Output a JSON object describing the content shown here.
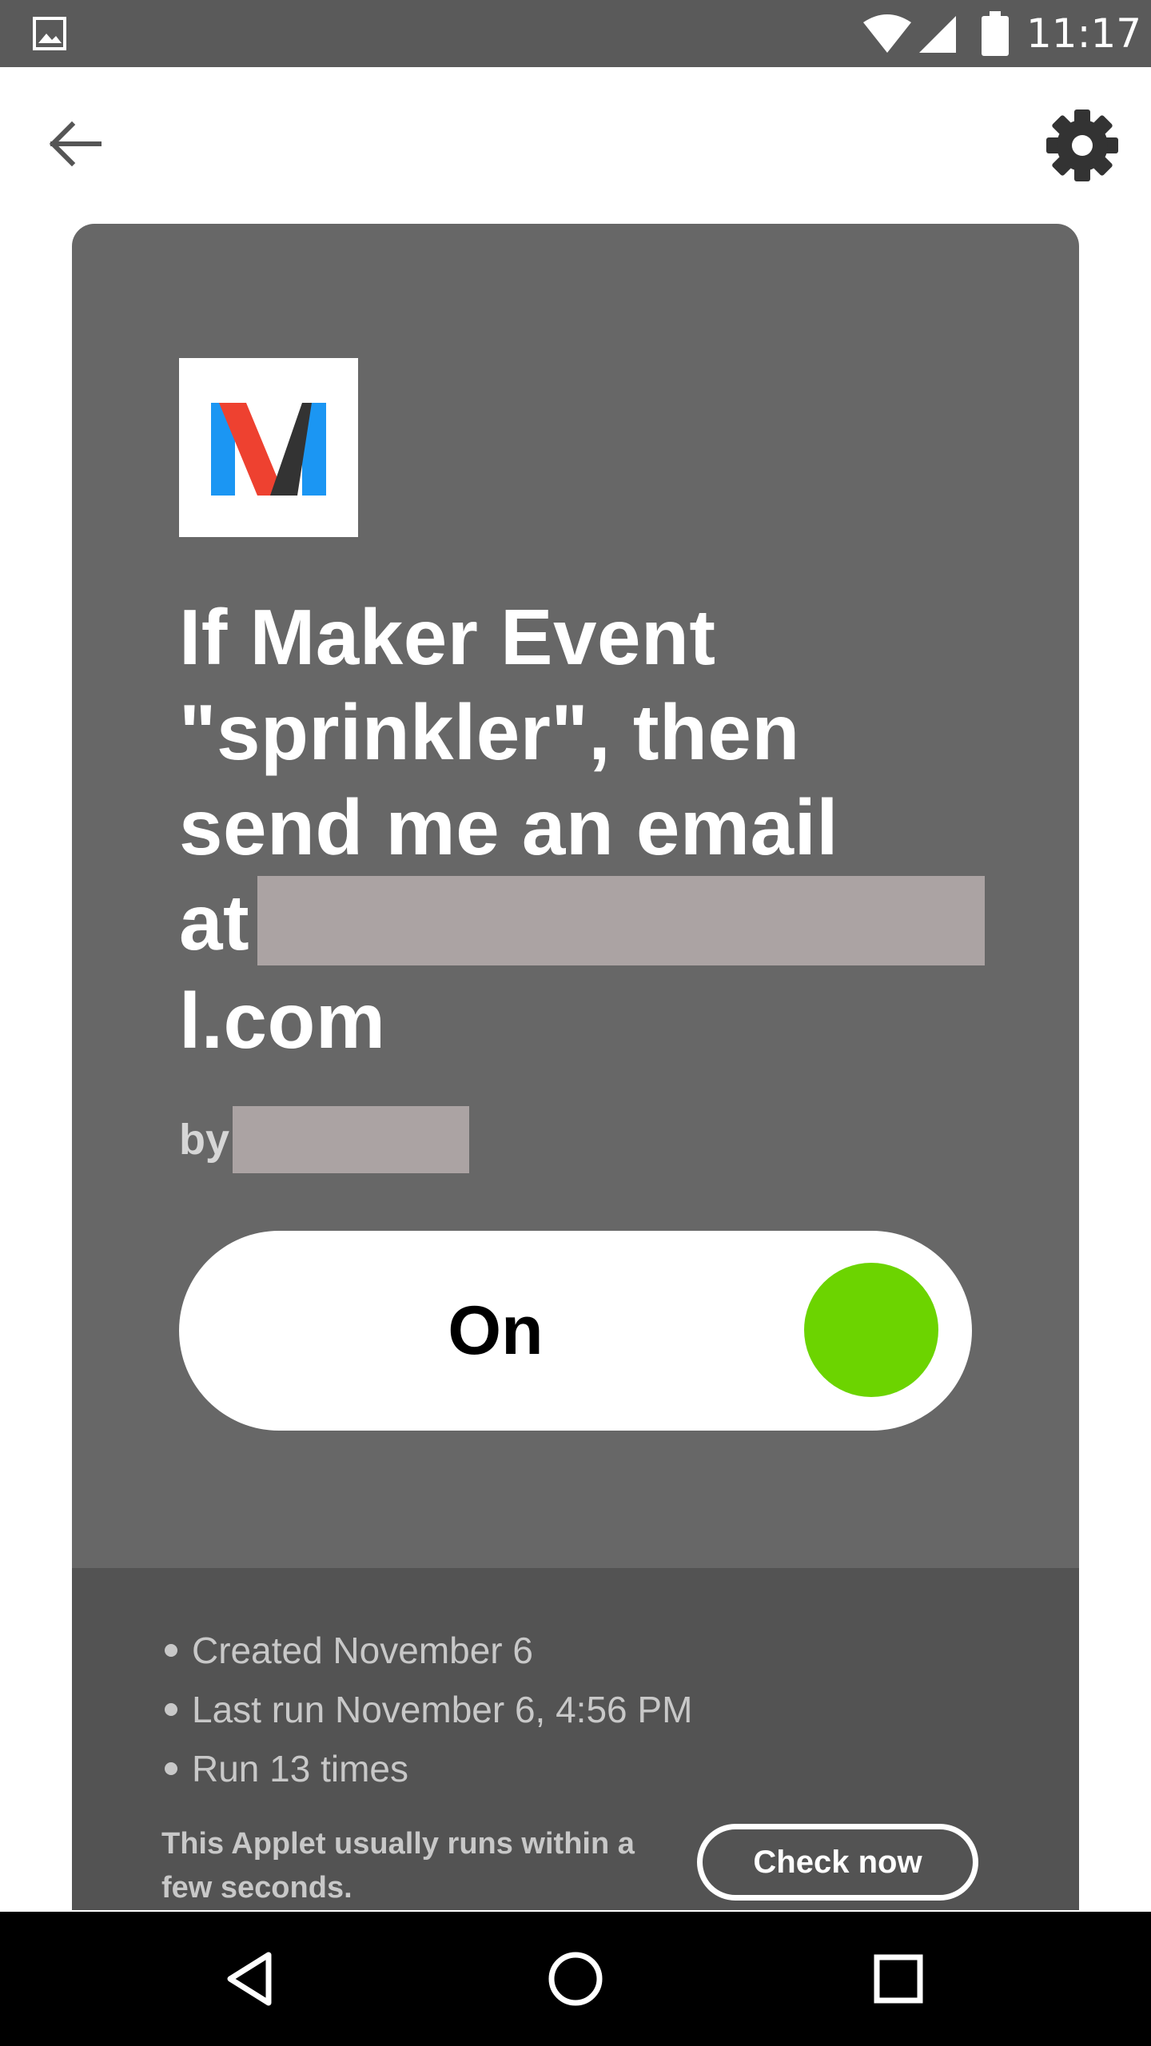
{
  "status_bar": {
    "time": "11:17",
    "icons": [
      "gallery-icon",
      "wifi-icon",
      "signal-icon",
      "battery-icon"
    ]
  },
  "top_bar": {
    "back_icon": "arrow-left-icon",
    "settings_icon": "gear-icon"
  },
  "applet": {
    "service_logo": "maker-logo",
    "title_line1": "If Maker Event",
    "title_line2": "\"sprinkler\", then",
    "title_line3": "send me an email",
    "title_line4_prefix": "at",
    "title_line5": "l.com",
    "author_prefix": "by",
    "toggle": {
      "label": "On",
      "state": "on",
      "knob_color": "#6cd400"
    },
    "details": [
      "Created November 6",
      "Last run November 6, 4:56 PM",
      "Run 13 times"
    ],
    "speed_note": "This Applet usually runs within a few seconds.",
    "check_now_label": "Check now"
  },
  "nav_bar": {
    "icons": [
      "back-triangle-icon",
      "home-circle-icon",
      "recents-square-icon"
    ]
  },
  "colors": {
    "status_bar": "#5a5a5a",
    "card": "#676767",
    "card_footer": "#535353",
    "redaction": "#aba3a3",
    "toggle_on": "#6cd400"
  }
}
